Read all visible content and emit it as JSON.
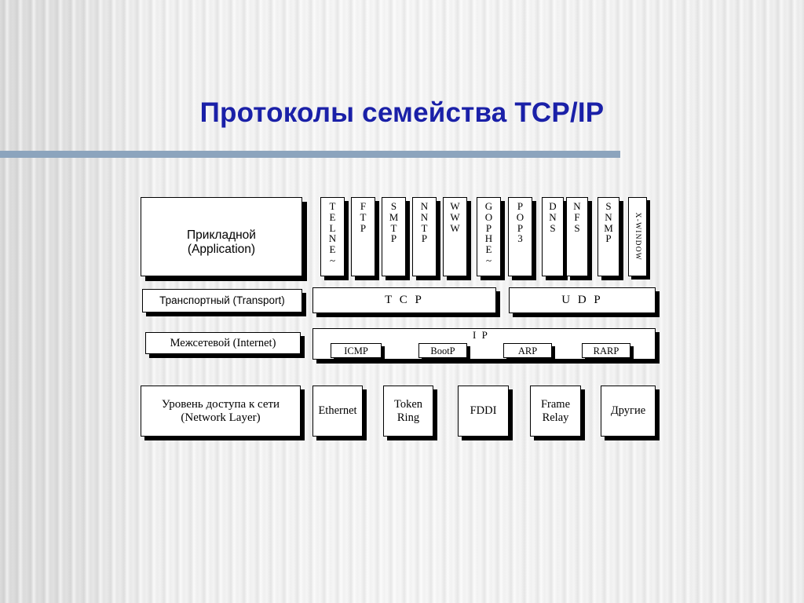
{
  "slide": {
    "title": "Протоколы семейства TCP/IP",
    "accent_color": "#1a20a8",
    "rule_color": "#8ca4bd",
    "background_color": "#f2f2f2"
  },
  "diagram": {
    "layers": [
      {
        "id": "application",
        "label": "Прикладной\n(Application)",
        "label_line1": "Прикладной",
        "label_line2": "(Application)",
        "protocols": [
          {
            "name": "TELNE~",
            "orientation": "stacked"
          },
          {
            "name": "FTP",
            "orientation": "stacked"
          },
          {
            "name": "SMTP",
            "orientation": "stacked"
          },
          {
            "name": "NNTP",
            "orientation": "stacked"
          },
          {
            "name": "WWW",
            "orientation": "stacked"
          },
          {
            "name": "GOPHE~",
            "orientation": "stacked"
          },
          {
            "name": "POP3",
            "orientation": "stacked"
          },
          {
            "name": "DNS",
            "orientation": "stacked"
          },
          {
            "name": "NFS",
            "orientation": "stacked"
          },
          {
            "name": "SNMP",
            "orientation": "stacked"
          },
          {
            "name": "X-WINDOW",
            "orientation": "rotated"
          }
        ]
      },
      {
        "id": "transport",
        "label": "Транспортный (Transport)",
        "protocols": [
          {
            "name": "T C P"
          },
          {
            "name": "U D P"
          }
        ]
      },
      {
        "id": "internet",
        "label": "Межсетевой (Internet)",
        "container": "I P",
        "protocols": [
          {
            "name": "ICMP"
          },
          {
            "name": "BootP"
          },
          {
            "name": "ARP"
          },
          {
            "name": "RARP"
          }
        ]
      },
      {
        "id": "network-access",
        "label": "Уровень доступа к сети\n(Network Layer)",
        "label_line1": "Уровень доступа к сети",
        "label_line2": "(Network Layer)",
        "protocols": [
          {
            "name": "Ethernet"
          },
          {
            "name": "Token\nRing",
            "line1": "Token",
            "line2": "Ring"
          },
          {
            "name": "FDDI"
          },
          {
            "name": "Frame\nRelay",
            "line1": "Frame",
            "line2": "Relay"
          },
          {
            "name": "Другие"
          }
        ]
      }
    ]
  }
}
